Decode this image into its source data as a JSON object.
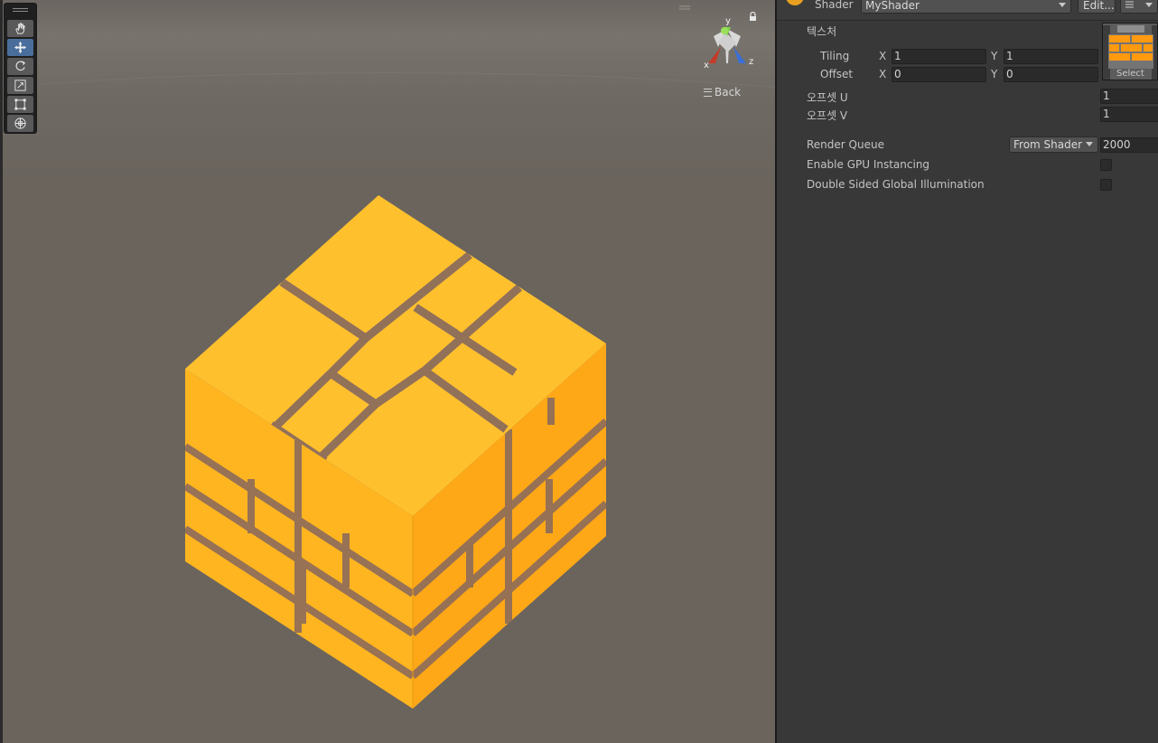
{
  "scene": {
    "back_label": "Back",
    "gizmo": {
      "y_label": "y",
      "x_label": "x",
      "z_label": "z"
    },
    "tools": [
      "hand-tool",
      "move-tool",
      "rotate-tool",
      "scale-tool",
      "rect-tool",
      "transform-tool"
    ],
    "active_tool": "move-tool",
    "colors": {
      "background": "#6b645c",
      "cube_top": "#ffc02e",
      "cube_left": "#ffb61f",
      "cube_right": "#ffa718",
      "mortar": "#8d6d5c"
    }
  },
  "inspector": {
    "shader_label": "Shader",
    "shader_value": "MyShader",
    "edit_button": "Edit...",
    "texture_label": "텍스처",
    "tiling_label": "Tiling",
    "tiling_x_label": "X",
    "tiling_x": "1",
    "tiling_y_label": "Y",
    "tiling_y": "1",
    "offset_label": "Offset",
    "offset_x_label": "X",
    "offset_x": "0",
    "offset_y_label": "Y",
    "offset_y": "0",
    "texture_select": "Select",
    "offset_u_label": "오프셋 U",
    "offset_u": "1",
    "offset_v_label": "오프셋 V",
    "offset_v": "1",
    "render_queue_label": "Render Queue",
    "render_queue_mode": "From Shader",
    "render_queue_value": "2000",
    "gpu_instancing_label": "Enable GPU Instancing",
    "gpu_instancing_checked": false,
    "double_sided_gi_label": "Double Sided Global Illumination",
    "double_sided_gi_checked": false
  }
}
